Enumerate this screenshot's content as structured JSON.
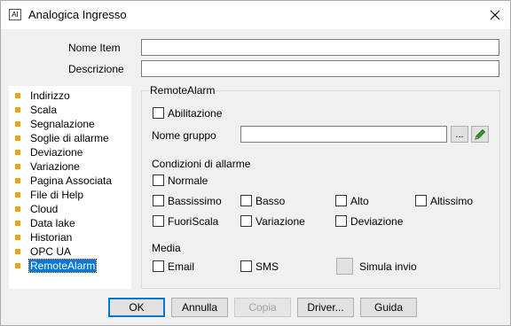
{
  "window": {
    "title": "Analogica Ingresso",
    "icon_text": "AI"
  },
  "form": {
    "name_label": "Nome Item",
    "name_value": "",
    "description_label": "Descrizione",
    "description_value": ""
  },
  "tree": {
    "items": [
      {
        "label": "Indirizzo",
        "selected": false
      },
      {
        "label": "Scala",
        "selected": false
      },
      {
        "label": "Segnalazione",
        "selected": false
      },
      {
        "label": "Soglie di allarme",
        "selected": false
      },
      {
        "label": "Deviazione",
        "selected": false
      },
      {
        "label": "Variazione",
        "selected": false
      },
      {
        "label": "Pagina Associata",
        "selected": false
      },
      {
        "label": "File di Help",
        "selected": false
      },
      {
        "label": "Cloud",
        "selected": false
      },
      {
        "label": "Data lake",
        "selected": false
      },
      {
        "label": "Historian",
        "selected": false
      },
      {
        "label": "OPC UA",
        "selected": false
      },
      {
        "label": "RemoteAlarm",
        "selected": true
      }
    ],
    "bullet_color": "#f0a30a"
  },
  "remote_alarm": {
    "group_title": "RemoteAlarm",
    "enable_label": "Abilitazione",
    "group_name_label": "Nome gruppo",
    "group_name_value": "",
    "browse_button_label": "...",
    "conditions_label": "Condizioni di allarme",
    "conditions": {
      "normale": "Normale",
      "bassissimo": "Bassissimo",
      "basso": "Basso",
      "alto": "Alto",
      "altissimo": "Altissimo",
      "fuoriscala": "FuoriScala",
      "variazione": "Variazione",
      "deviazione": "Deviazione"
    },
    "media_label": "Media",
    "email_label": "Email",
    "sms_label": "SMS",
    "simulate_label": "Simula invio"
  },
  "buttons": {
    "ok": "OK",
    "cancel": "Annulla",
    "copy": "Copia",
    "driver": "Driver...",
    "guide": "Guida"
  },
  "colors": {
    "accent": "#0078d7",
    "pencil": "#3c9a2c"
  }
}
